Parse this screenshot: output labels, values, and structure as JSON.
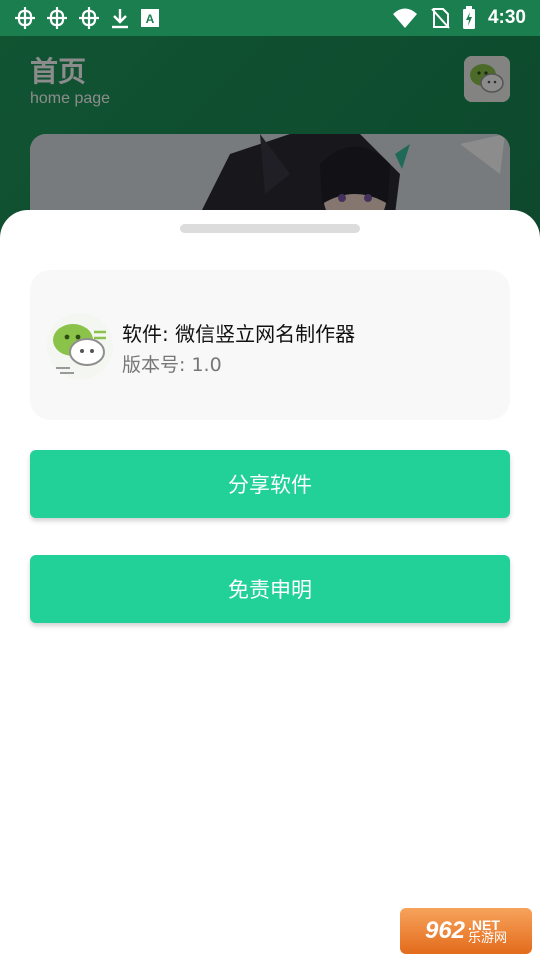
{
  "status_bar": {
    "time": "4:30",
    "left_icons": [
      "bug-icon",
      "bug-icon",
      "bug-icon",
      "download-icon",
      "a-icon"
    ],
    "right_icons": [
      "wifi-icon",
      "no-sim-icon",
      "battery-charging-icon"
    ]
  },
  "home": {
    "title": "首页",
    "subtitle": "home page"
  },
  "sheet": {
    "app_name": "软件: 微信竖立网名制作器",
    "app_version": "版本号: 1.0",
    "share_label": "分享软件",
    "disclaimer_label": "免责申明"
  },
  "watermark": {
    "number": "962",
    "suffix": ".NET",
    "cn": "乐游网"
  },
  "colors": {
    "accent": "#21d198",
    "header_green": "#1a7e4f",
    "card_bg": "#f8f8f8"
  }
}
